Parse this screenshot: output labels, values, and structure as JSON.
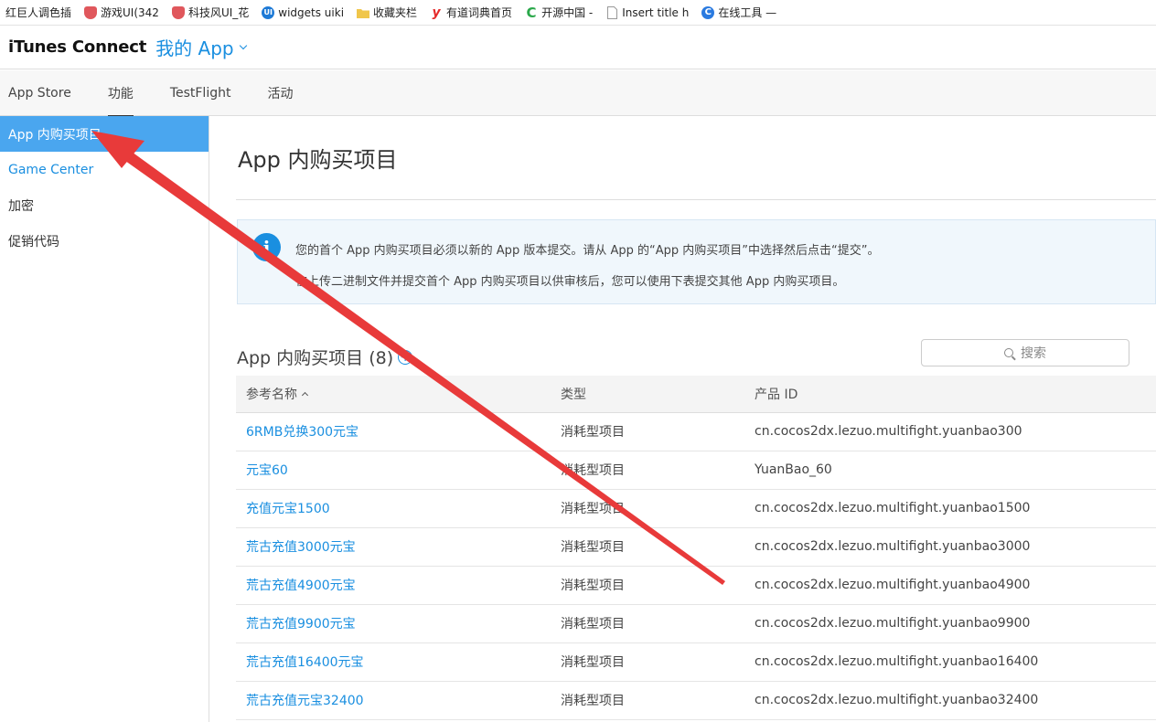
{
  "bookmarks": [
    {
      "label": "红巨人调色插",
      "icon": "none"
    },
    {
      "label": "游戏UI(342",
      "icon": "heart-icon"
    },
    {
      "label": "科技风UI_花",
      "icon": "heart-icon"
    },
    {
      "label": "widgets uiki",
      "icon": "ui-icon"
    },
    {
      "label": "收藏夹栏",
      "icon": "folder-icon"
    },
    {
      "label": "有道词典首页",
      "icon": "youdao-icon"
    },
    {
      "label": "开源中国 -",
      "icon": "oschina-icon"
    },
    {
      "label": "Insert title h",
      "icon": "page-icon"
    },
    {
      "label": "在线工具 —",
      "icon": "tool-icon"
    }
  ],
  "header": {
    "brand": "iTunes Connect",
    "app_menu": "我的 App"
  },
  "tabs": [
    {
      "label": "App Store",
      "active": false
    },
    {
      "label": "功能",
      "active": true
    },
    {
      "label": "TestFlight",
      "active": false
    },
    {
      "label": "活动",
      "active": false
    }
  ],
  "sidebar": {
    "items": [
      {
        "label": "App 内购买项目",
        "state": "active"
      },
      {
        "label": "Game Center",
        "state": "link"
      },
      {
        "label": "加密",
        "state": "normal"
      },
      {
        "label": "促销代码",
        "state": "normal"
      }
    ]
  },
  "main": {
    "title": "App 内购买项目",
    "info": {
      "line1": "您的首个 App 内购买项目必须以新的 App 版本提交。请从 App 的“App 内购买项目”中选择然后点击“提交”。",
      "line2": "在上传二进制文件并提交首个 App 内购买项目以供审核后，您可以使用下表提交其他 App 内购买项目。"
    },
    "section_title": "App 内购买项目 (8)",
    "search_placeholder": "搜索",
    "table": {
      "headers": [
        "参考名称",
        "类型",
        "产品 ID"
      ],
      "rows": [
        [
          "6RMB兑换300元宝",
          "消耗型项目",
          "cn.cocos2dx.lezuo.multifight.yuanbao300"
        ],
        [
          "元宝60",
          "消耗型项目",
          "YuanBao_60"
        ],
        [
          "充值元宝1500",
          "消耗型项目",
          "cn.cocos2dx.lezuo.multifight.yuanbao1500"
        ],
        [
          "荒古充值3000元宝",
          "消耗型项目",
          "cn.cocos2dx.lezuo.multifight.yuanbao3000"
        ],
        [
          "荒古充值4900元宝",
          "消耗型项目",
          "cn.cocos2dx.lezuo.multifight.yuanbao4900"
        ],
        [
          "荒古充值9900元宝",
          "消耗型项目",
          "cn.cocos2dx.lezuo.multifight.yuanbao9900"
        ],
        [
          "荒古充值16400元宝",
          "消耗型项目",
          "cn.cocos2dx.lezuo.multifight.yuanbao16400"
        ],
        [
          "荒古充值元宝32400",
          "消耗型项目",
          "cn.cocos2dx.lezuo.multifight.yuanbao32400"
        ]
      ]
    }
  },
  "colors": {
    "accent": "#1a8fe0",
    "sidebar_active": "#4aa6ef",
    "annotation_arrow": "#e83a3a"
  }
}
